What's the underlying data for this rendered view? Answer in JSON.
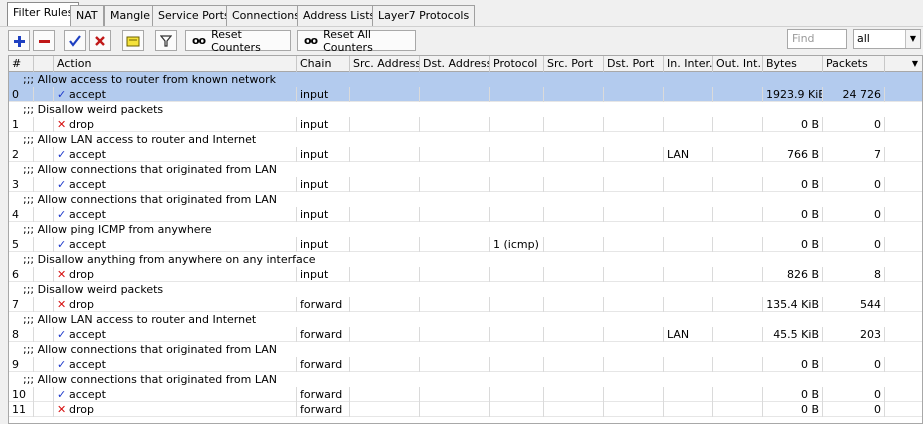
{
  "tabs": [
    "Filter Rules",
    "NAT",
    "Mangle",
    "Service Ports",
    "Connections",
    "Address Lists",
    "Layer7 Protocols"
  ],
  "toolbar": {
    "reset_counters": "Reset Counters",
    "reset_all_counters": "Reset All Counters",
    "counter_icon": "oo",
    "find_placeholder": "Find",
    "filter_value": "all"
  },
  "columns": {
    "num": "#",
    "action": "Action",
    "chain": "Chain",
    "src_address": "Src. Address",
    "dst_address": "Dst. Address",
    "protocol": "Protocol",
    "src_port": "Src. Port",
    "dst_port": "Dst. Port",
    "in_interface": "In. Inter...",
    "out_interface": "Out. Int...",
    "bytes": "Bytes",
    "packets": "Packets"
  },
  "rows": [
    {
      "comment": ";;; Allow access to router from known network",
      "num": "0",
      "action": "accept",
      "chain": "input",
      "protocol": "",
      "in_interface": "",
      "bytes": "1923.9 KiB",
      "packets": "24 726",
      "selected": true
    },
    {
      "comment": ";;; Disallow weird packets",
      "num": "1",
      "action": "drop",
      "chain": "input",
      "protocol": "",
      "in_interface": "",
      "bytes": "0 B",
      "packets": "0"
    },
    {
      "comment": ";;; Allow LAN access to router and Internet",
      "num": "2",
      "action": "accept",
      "chain": "input",
      "protocol": "",
      "in_interface": "LAN",
      "bytes": "766 B",
      "packets": "7"
    },
    {
      "comment": ";;; Allow connections that originated from LAN",
      "num": "3",
      "action": "accept",
      "chain": "input",
      "protocol": "",
      "in_interface": "",
      "bytes": "0 B",
      "packets": "0"
    },
    {
      "comment": ";;; Allow connections that originated from LAN",
      "num": "4",
      "action": "accept",
      "chain": "input",
      "protocol": "",
      "in_interface": "",
      "bytes": "0 B",
      "packets": "0"
    },
    {
      "comment": ";;; Allow ping ICMP from anywhere",
      "num": "5",
      "action": "accept",
      "chain": "input",
      "protocol": "1 (icmp)",
      "in_interface": "",
      "bytes": "0 B",
      "packets": "0"
    },
    {
      "comment": ";;; Disallow anything from anywhere on any interface",
      "num": "6",
      "action": "drop",
      "chain": "input",
      "protocol": "",
      "in_interface": "",
      "bytes": "826 B",
      "packets": "8"
    },
    {
      "comment": ";;; Disallow weird packets",
      "num": "7",
      "action": "drop",
      "chain": "forward",
      "protocol": "",
      "in_interface": "",
      "bytes": "135.4 KiB",
      "packets": "544"
    },
    {
      "comment": ";;; Allow LAN access to router and Internet",
      "num": "8",
      "action": "accept",
      "chain": "forward",
      "protocol": "",
      "in_interface": "LAN",
      "bytes": "45.5 KiB",
      "packets": "203"
    },
    {
      "comment": ";;; Allow connections that originated from LAN",
      "num": "9",
      "action": "accept",
      "chain": "forward",
      "protocol": "",
      "in_interface": "",
      "bytes": "0 B",
      "packets": "0"
    },
    {
      "comment": ";;; Allow connections that originated from LAN",
      "num": "10",
      "action": "accept",
      "chain": "forward",
      "protocol": "",
      "in_interface": "",
      "bytes": "0 B",
      "packets": "0"
    },
    {
      "comment": "",
      "num": "11",
      "action": "drop",
      "chain": "forward",
      "protocol": "",
      "in_interface": "",
      "bytes": "0 B",
      "packets": "0"
    }
  ],
  "colors": {
    "accept": "#1a36c9",
    "drop": "#d61010",
    "selected_row": "#b3cbee"
  }
}
